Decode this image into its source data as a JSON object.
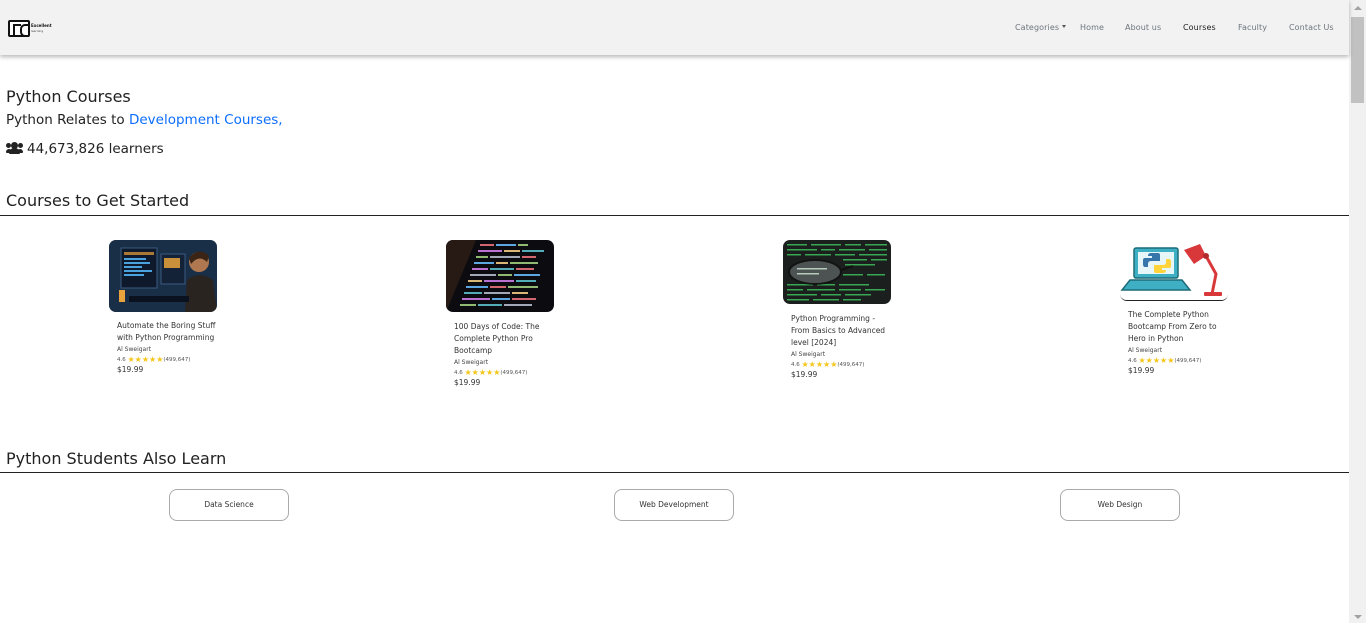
{
  "nav": {
    "logo_text": "Excellent",
    "logo_sub": "learning",
    "items": [
      {
        "label": "Categories",
        "has_caret": true
      },
      {
        "label": "Home"
      },
      {
        "label": "About us"
      },
      {
        "label": "Courses",
        "active": true
      },
      {
        "label": "Faculty"
      },
      {
        "label": "Contact Us"
      }
    ]
  },
  "header": {
    "title": "Python Courses",
    "relates_prefix": "Python Relates to ",
    "relates_link": "Development Courses,",
    "learners": "44,673,826 learners",
    "learners_icon": "users-icon"
  },
  "sections": {
    "started": "Courses to Get Started",
    "also_learn": "Python Students Also Learn"
  },
  "courses": [
    {
      "title": "Automate the Boring Stuff with Python Programming",
      "author": "Al Sweigart",
      "rating": "4.6",
      "stars": "★★★★★",
      "reviews": "(499,647)",
      "price": "$19.99",
      "thumb": "person-at-computer"
    },
    {
      "title": "100 Days of Code: The Complete Python Pro Bootcamp",
      "author": "Al Sweigart",
      "rating": "4.6",
      "stars": "★★★★★",
      "reviews": "(499,647)",
      "price": "$19.99",
      "thumb": "code-on-screen"
    },
    {
      "title": "Python Programming - From Basics to Advanced level [2024]",
      "author": "Al Sweigart",
      "rating": "4.6",
      "stars": "★★★★★",
      "reviews": "(499,647)",
      "price": "$19.99",
      "thumb": "glasses-on-code"
    },
    {
      "title": "The Complete Python Bootcamp From Zero to Hero in Python",
      "author": "Al Sweigart",
      "rating": "4.6",
      "stars": "★★★★★",
      "reviews": "(499,647)",
      "price": "$19.99",
      "thumb": "python-laptop-lamp"
    }
  ],
  "topics": [
    "Data Science",
    "Web Development",
    "Web Design"
  ],
  "colors": {
    "link": "#0d6efd",
    "star": "#f5c518",
    "navbar": "#f2f2f2"
  }
}
